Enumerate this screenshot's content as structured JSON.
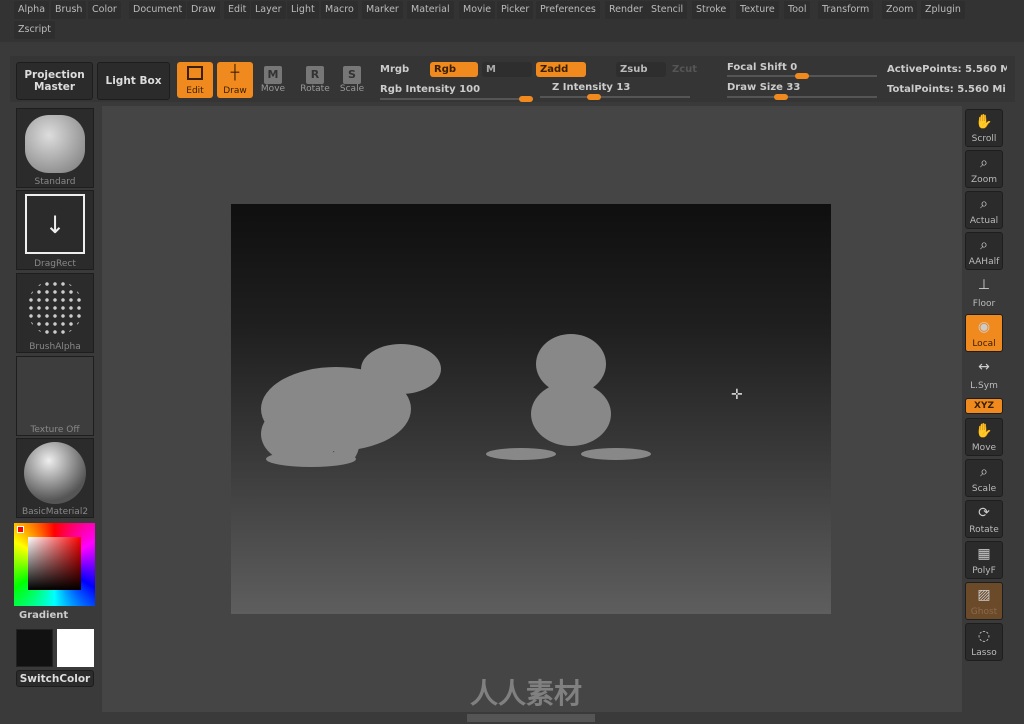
{
  "menu": {
    "items": [
      "Alpha",
      "Brush",
      "Color",
      "Document",
      "Draw",
      "Edit",
      "Layer",
      "Light",
      "Macro",
      "Marker",
      "Material",
      "Movie",
      "Picker",
      "Preferences",
      "Render",
      "Stencil",
      "Stroke",
      "Texture",
      "Tool",
      "Transform",
      "Zoom",
      "Zplugin"
    ],
    "row2": [
      "Zscript"
    ]
  },
  "toolbar": {
    "projection_master": "Projection Master",
    "light_box": "Light Box",
    "edit": "Edit",
    "draw": "Draw",
    "move": "Move",
    "rotate": "Rotate",
    "scale": "Scale",
    "move_key": "M",
    "rotate_key": "R",
    "scale_key": "S",
    "mrgb": "Mrgb",
    "rgb": "Rgb",
    "m": "M",
    "zadd": "Zadd",
    "zsub": "Zsub",
    "zcut": "Zcut",
    "rgb_intensity_label": "Rgb Intensity",
    "rgb_intensity": "100",
    "z_intensity_label": "Z Intensity",
    "z_intensity": "13",
    "focal_shift_label": "Focal Shift",
    "focal_shift": "0",
    "draw_size_label": "Draw Size",
    "draw_size": "33",
    "active_points": "ActivePoints: 5.560 M",
    "total_points": "TotalPoints: 5.560 Mi"
  },
  "left": {
    "brush": "Standard",
    "stroke": "DragRect",
    "alpha": "BrushAlpha",
    "texture": "Texture Off",
    "material": "BasicMaterial2",
    "gradient": "Gradient",
    "switch_color": "SwitchColor",
    "main_color": "#111111",
    "secondary_color": "#ffffff"
  },
  "right": {
    "items": [
      "Scroll",
      "Zoom",
      "Actual",
      "AAHalf",
      "Floor",
      "Local",
      "L.Sym",
      "XYZ",
      "Move",
      "Scale",
      "Rotate",
      "PolyF",
      "Ghost",
      "Lasso"
    ]
  },
  "watermark": "人人素材",
  "accent": "#f08a1e"
}
